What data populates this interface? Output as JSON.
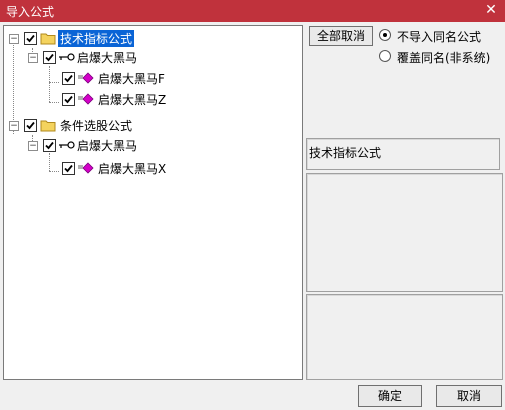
{
  "window": {
    "title": "导入公式"
  },
  "tree": {
    "groups": [
      {
        "label": "技术指标公式",
        "children": [
          {
            "label": "启爆大黑马",
            "children": [
              "启爆大黑马F",
              "启爆大黑马Z"
            ]
          }
        ]
      },
      {
        "label": "条件选股公式",
        "children": [
          {
            "label": "启爆大黑马",
            "children": [
              "启爆大黑马X"
            ]
          }
        ]
      }
    ]
  },
  "options": {
    "cancel_all_label": "全部取消",
    "radio_skip_label": "不导入同名公式",
    "radio_overwrite_label": "覆盖同名(非系统)",
    "selected": "skip"
  },
  "info": {
    "category_label": "技术指标公式"
  },
  "footer": {
    "ok_label": "确定",
    "cancel_label": "取消"
  },
  "colors": {
    "titlebar": "#c0323c",
    "selection": "#0a64d6",
    "diamond": "#d400c8",
    "folder": "#f4d35e"
  }
}
